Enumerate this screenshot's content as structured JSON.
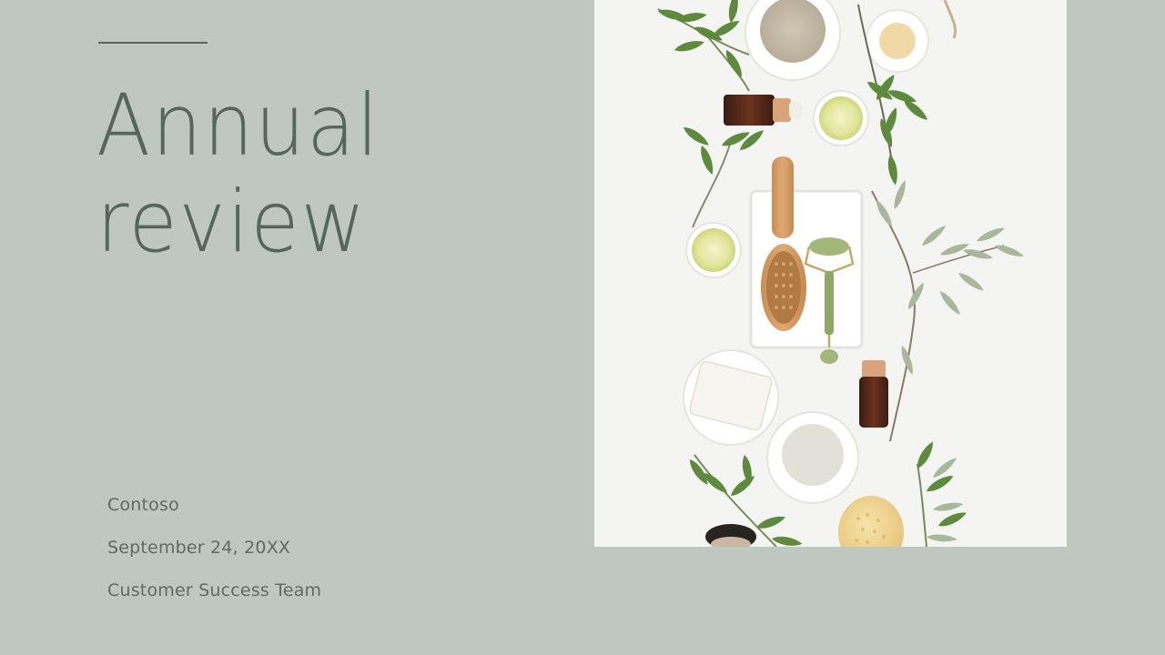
{
  "slide": {
    "title_line1": "Annual",
    "title_line2": "review",
    "company": "Contoso",
    "date": "September 24, 20XX",
    "team": "Customer Success Team"
  },
  "colors": {
    "background": "#bfc8c0",
    "title": "#56665c",
    "text": "#5d6b62",
    "photo_background": "#f4f5f3"
  },
  "photo": {
    "icons": [
      "olive-branch-icon",
      "clay-bowl-icon",
      "cream-jar-icon",
      "serum-bottle-icon",
      "oil-dish-icon",
      "wooden-brush-icon",
      "jade-roller-icon",
      "soap-dish-icon",
      "sponge-icon",
      "makeup-brush-icon"
    ]
  }
}
